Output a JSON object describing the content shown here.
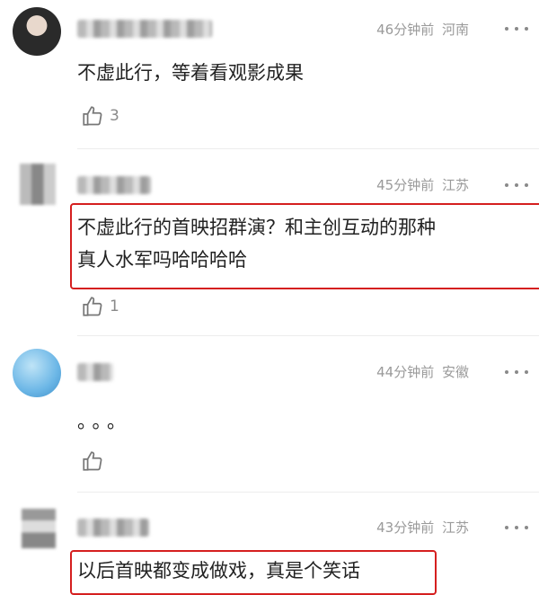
{
  "comments": [
    {
      "time": "46分钟前",
      "location": "河南",
      "text_lines": [
        "不虚此行，等着看观影成果"
      ],
      "likes": "3"
    },
    {
      "time": "45分钟前",
      "location": "江苏",
      "text_lines": [
        "不虚此行的首映招群演？和主创互动的那种",
        "真人水军吗哈哈哈哈"
      ],
      "likes": "1"
    },
    {
      "time": "44分钟前",
      "location": "安徽",
      "text_lines": [
        "。。。"
      ],
      "likes": ""
    },
    {
      "time": "43分钟前",
      "location": "江苏",
      "text_lines": [
        "以后首映都变成做戏，真是个笑话"
      ],
      "likes": ""
    }
  ],
  "colors": {
    "highlight_border": "#d51f1f",
    "meta_text": "#9a9a9a"
  },
  "icons": {
    "like": "thumbs-up-icon",
    "more": "more-dots-icon"
  }
}
